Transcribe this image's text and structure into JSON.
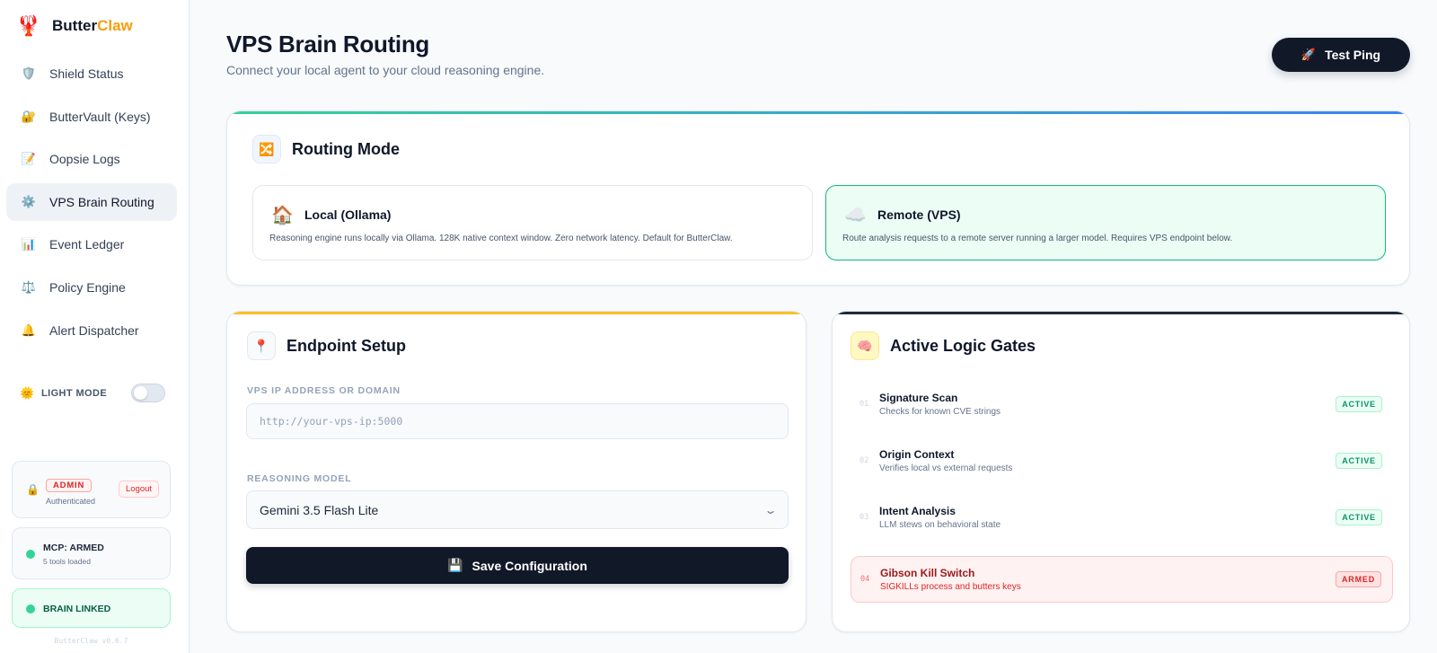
{
  "brand": {
    "name_main": "Butter",
    "name_accent": "Claw",
    "logo_icon": "lobster-icon"
  },
  "nav": [
    {
      "label": "Shield Status",
      "icon": "🛡️",
      "active": false
    },
    {
      "label": "ButterVault (Keys)",
      "icon": "🔐",
      "active": false
    },
    {
      "label": "Oopsie Logs",
      "icon": "📝",
      "active": false
    },
    {
      "label": "VPS Brain Routing",
      "icon": "⚙️",
      "active": true
    },
    {
      "label": "Event Ledger",
      "icon": "📊",
      "active": false
    },
    {
      "label": "Policy Engine",
      "icon": "⚖️",
      "active": false
    },
    {
      "label": "Alert Dispatcher",
      "icon": "🔔",
      "active": false
    }
  ],
  "theme": {
    "label": "LIGHT MODE",
    "icon": "🌞",
    "dark_enabled": false
  },
  "admin": {
    "icon": "🔒",
    "badge": "ADMIN",
    "sub": "Authenticated",
    "logout_label": "Logout"
  },
  "mcp": {
    "title": "MCP: ARMED",
    "sub": "5 tools loaded"
  },
  "brain": {
    "title": "BRAIN LINKED"
  },
  "version": "ButterClaw v0.6.7",
  "header": {
    "title": "VPS Brain Routing",
    "subtitle": "Connect your local agent to your cloud reasoning engine.",
    "test_ping_label": "Test Ping",
    "test_ping_icon": "🚀"
  },
  "routing": {
    "title": "Routing Mode",
    "icon": "🔀",
    "local": {
      "icon": "🏠",
      "name": "Local (Ollama)",
      "desc": "Reasoning engine runs locally via Ollama. 128K native context window. Zero network latency. Default for ButterClaw.",
      "selected": false
    },
    "remote": {
      "icon": "☁️",
      "name": "Remote (VPS)",
      "desc": "Route analysis requests to a remote server running a larger model. Requires VPS endpoint below.",
      "selected": true
    }
  },
  "endpoint": {
    "title": "Endpoint Setup",
    "icon": "📍",
    "ip_label": "VPS IP ADDRESS OR DOMAIN",
    "ip_placeholder": "http://your-vps-ip:5000",
    "ip_value": "",
    "model_label": "REASONING MODEL",
    "model_value": "Gemini 3.5 Flash Lite",
    "save_label": "Save Configuration",
    "save_icon": "💾"
  },
  "gates": {
    "title": "Active Logic Gates",
    "icon": "🧠",
    "items": [
      {
        "num": "01",
        "name": "Signature Scan",
        "desc": "Checks for known CVE strings",
        "status": "ACTIVE",
        "armed": false
      },
      {
        "num": "02",
        "name": "Origin Context",
        "desc": "Verifies local vs external requests",
        "status": "ACTIVE",
        "armed": false
      },
      {
        "num": "03",
        "name": "Intent Analysis",
        "desc": "LLM stews on behavioral state",
        "status": "ACTIVE",
        "armed": false
      },
      {
        "num": "04",
        "name": "Gibson Kill Switch",
        "desc": "SIGKILLs process and butters keys",
        "status": "ARMED",
        "armed": true
      }
    ]
  }
}
